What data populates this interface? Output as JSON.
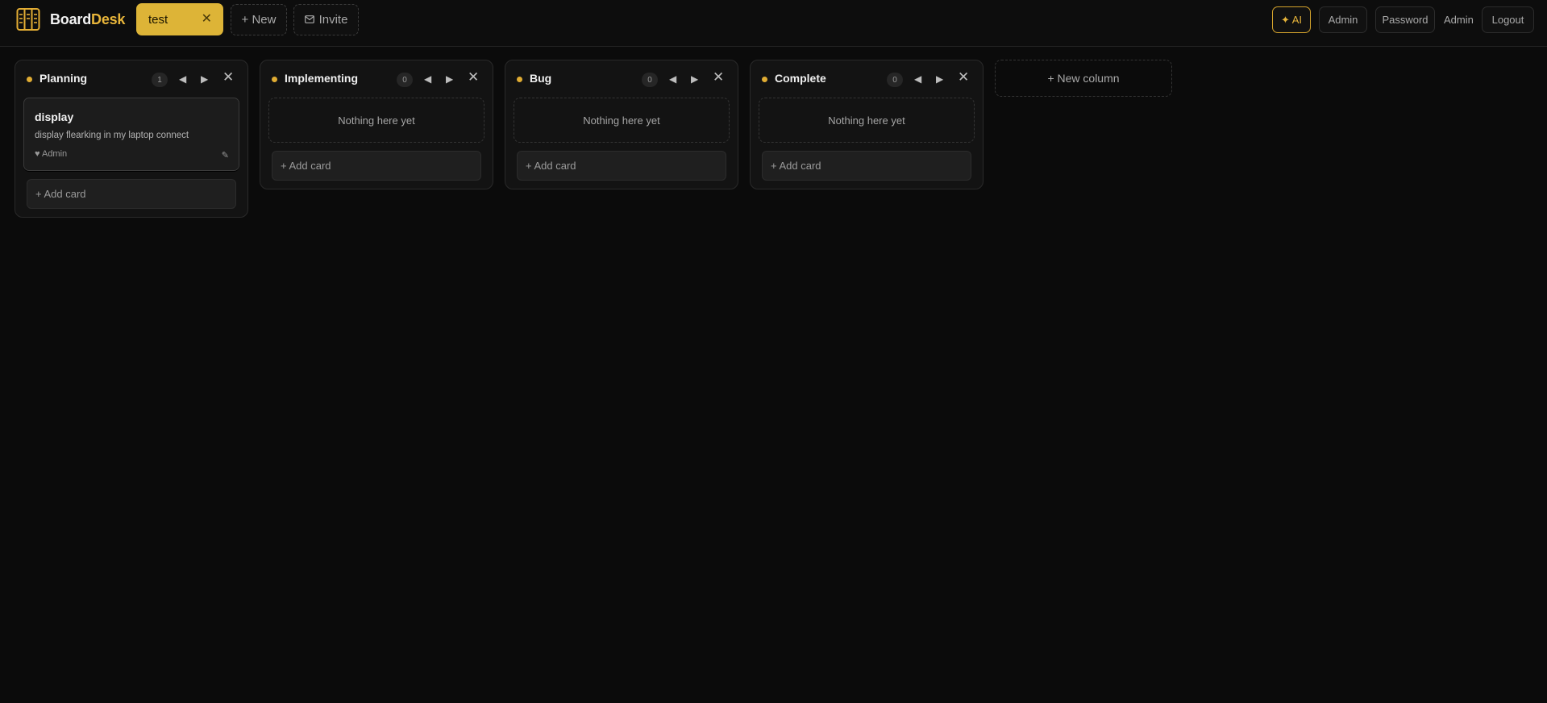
{
  "app": {
    "name_part1": "Board",
    "name_part2": "Desk",
    "accent_color": "#e8b53a",
    "logo_icon": "columns-logo-icon"
  },
  "header": {
    "active_board": {
      "label": "test",
      "close_icon": "close-icon"
    },
    "new_board_label": "+ New",
    "invite_label": "Invite",
    "invite_icon": "mail-icon",
    "ai_label": "✦ AI",
    "admin_label": "Admin",
    "password_label": "Password",
    "user_name": "Admin",
    "logout_label": "Logout"
  },
  "columns": [
    {
      "title": "Planning",
      "count": "1",
      "add_card_label": "+ Add card",
      "cards": [
        {
          "title": "display",
          "description": "display flearking in my laptop connect",
          "owner": "♥ Admin",
          "edit_icon": "edit-icon"
        }
      ]
    },
    {
      "title": "Implementing",
      "count": "0",
      "empty_text": "Nothing here yet",
      "add_card_label": "+ Add card",
      "cards": []
    },
    {
      "title": "Bug",
      "count": "0",
      "empty_text": "Nothing here yet",
      "add_card_label": "+ Add card",
      "cards": []
    },
    {
      "title": "Complete",
      "count": "0",
      "empty_text": "Nothing here yet",
      "add_card_label": "+ Add card",
      "cards": []
    }
  ],
  "new_column_label": "+ New column",
  "icons": {
    "move_left": "◀",
    "move_right": "▶",
    "close": "✕",
    "edit": "✎"
  }
}
